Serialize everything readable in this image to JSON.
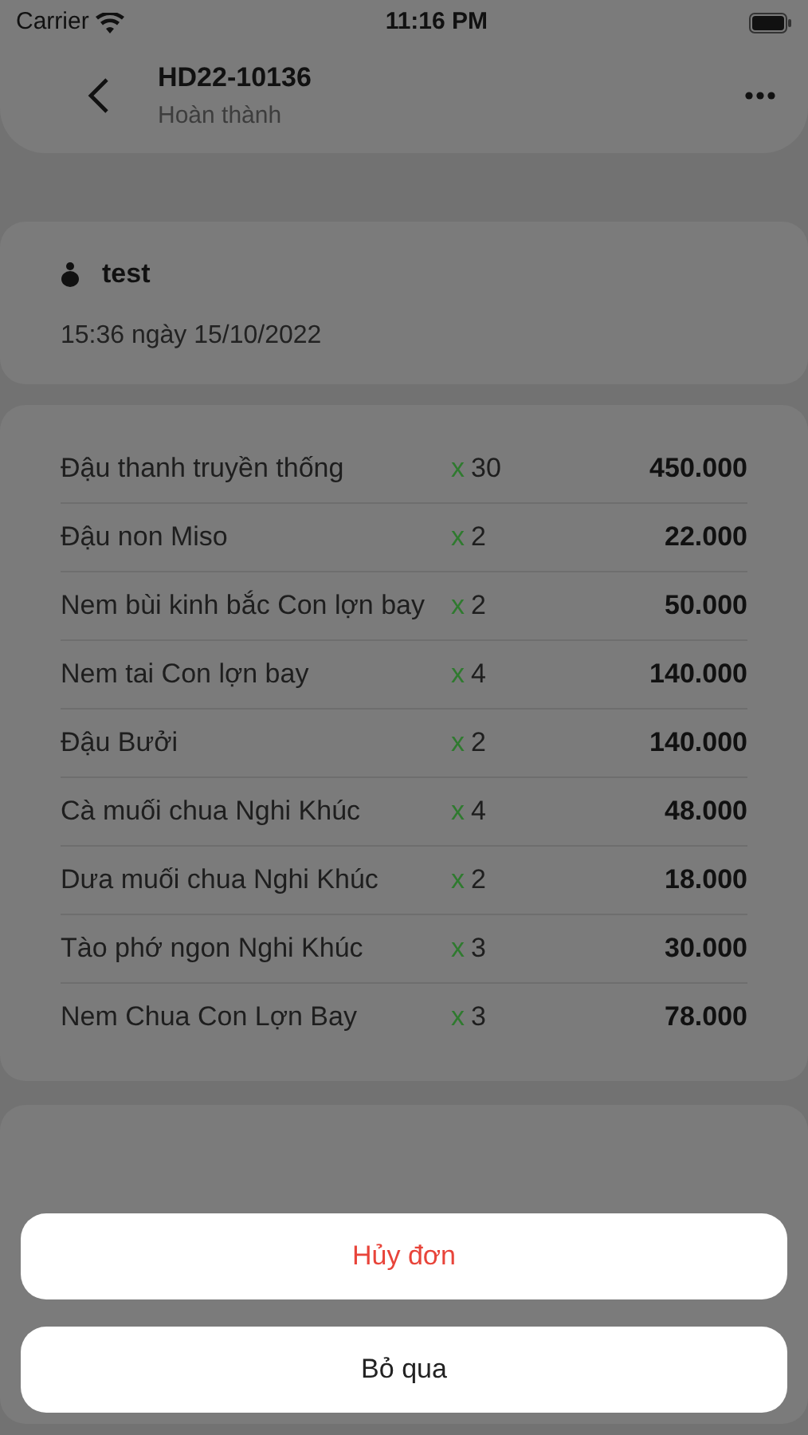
{
  "status_bar": {
    "carrier": "Carrier",
    "time": "11:16 PM"
  },
  "header": {
    "title": "HD22-10136",
    "status": "Hoàn thành"
  },
  "customer": {
    "name": "test",
    "datetime": "15:36 ngày 15/10/2022"
  },
  "items": [
    {
      "name": "Đậu thanh truyền thống",
      "qty_mark": "x",
      "qty": "30",
      "price": "450.000"
    },
    {
      "name": "Đậu non Miso",
      "qty_mark": "x",
      "qty": "2",
      "price": "22.000"
    },
    {
      "name": "Nem bùi kinh bắc Con lợn bay",
      "qty_mark": "x",
      "qty": "2",
      "price": "50.000"
    },
    {
      "name": "Nem tai Con lợn bay",
      "qty_mark": "x",
      "qty": "4",
      "price": "140.000"
    },
    {
      "name": "Đậu Bưởi",
      "qty_mark": "x",
      "qty": "2",
      "price": "140.000"
    },
    {
      "name": "Cà muối chua Nghi Khúc",
      "qty_mark": "x",
      "qty": "4",
      "price": "48.000"
    },
    {
      "name": "Dưa muối chua Nghi Khúc",
      "qty_mark": "x",
      "qty": "2",
      "price": "18.000"
    },
    {
      "name": "Tào phớ ngon Nghi Khúc",
      "qty_mark": "x",
      "qty": "3",
      "price": "30.000"
    },
    {
      "name": "Nem Chua Con Lợn Bay",
      "qty_mark": "x",
      "qty": "3",
      "price": "78.000"
    }
  ],
  "action_sheet": [
    {
      "label": "Hủy đơn",
      "kind": "destructive"
    },
    {
      "label": "Bỏ qua",
      "kind": "cancel"
    }
  ]
}
